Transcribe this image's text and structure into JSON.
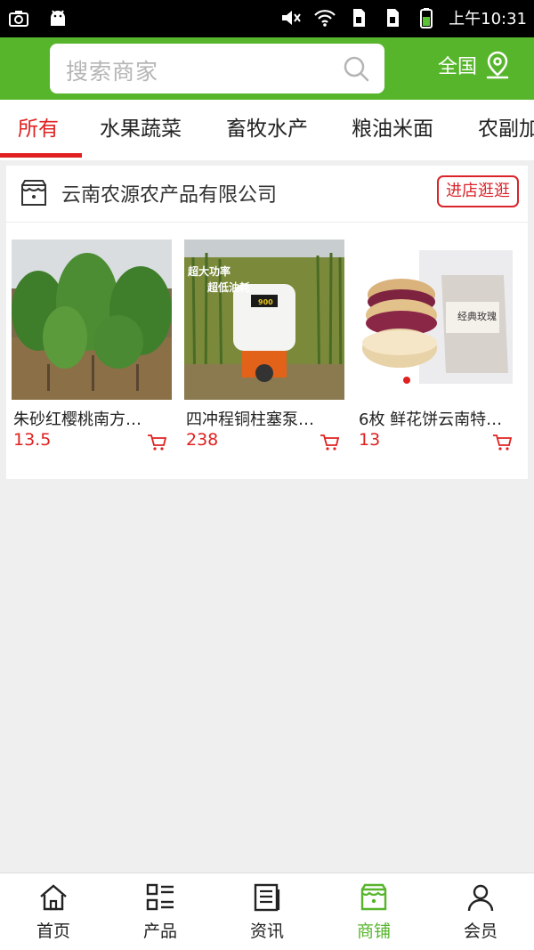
{
  "status_bar": {
    "time": "上午10:31"
  },
  "header": {
    "search_placeholder": "搜索商家",
    "region_label": "全国"
  },
  "tabs": [
    {
      "label": "所有",
      "active": true
    },
    {
      "label": "水果蔬菜",
      "active": false
    },
    {
      "label": "畜牧水产",
      "active": false
    },
    {
      "label": "粮油米面",
      "active": false
    },
    {
      "label": "农副加",
      "active": false
    }
  ],
  "shop": {
    "name": "云南农源农产品有限公司",
    "enter_label": "进店逛逛",
    "products": [
      {
        "title": "朱砂红樱桃南方…",
        "price": "13.5"
      },
      {
        "title": "四冲程铜柱塞泵…",
        "price": "238",
        "image_caption_1": "超大功率",
        "image_caption_2": "超低油耗",
        "image_badge": "900"
      },
      {
        "title": "6枚 鲜花饼云南特…",
        "price": "13",
        "package_text": "经典玫瑰"
      }
    ]
  },
  "bottom_nav": [
    {
      "label": "首页",
      "icon": "home-icon",
      "active": false
    },
    {
      "label": "产品",
      "icon": "list-icon",
      "active": false
    },
    {
      "label": "资讯",
      "icon": "news-icon",
      "active": false
    },
    {
      "label": "商铺",
      "icon": "shop-icon",
      "active": true
    },
    {
      "label": "会员",
      "icon": "user-icon",
      "active": false
    }
  ],
  "colors": {
    "brand_green": "#57b52c",
    "accent_red": "#e02020"
  }
}
